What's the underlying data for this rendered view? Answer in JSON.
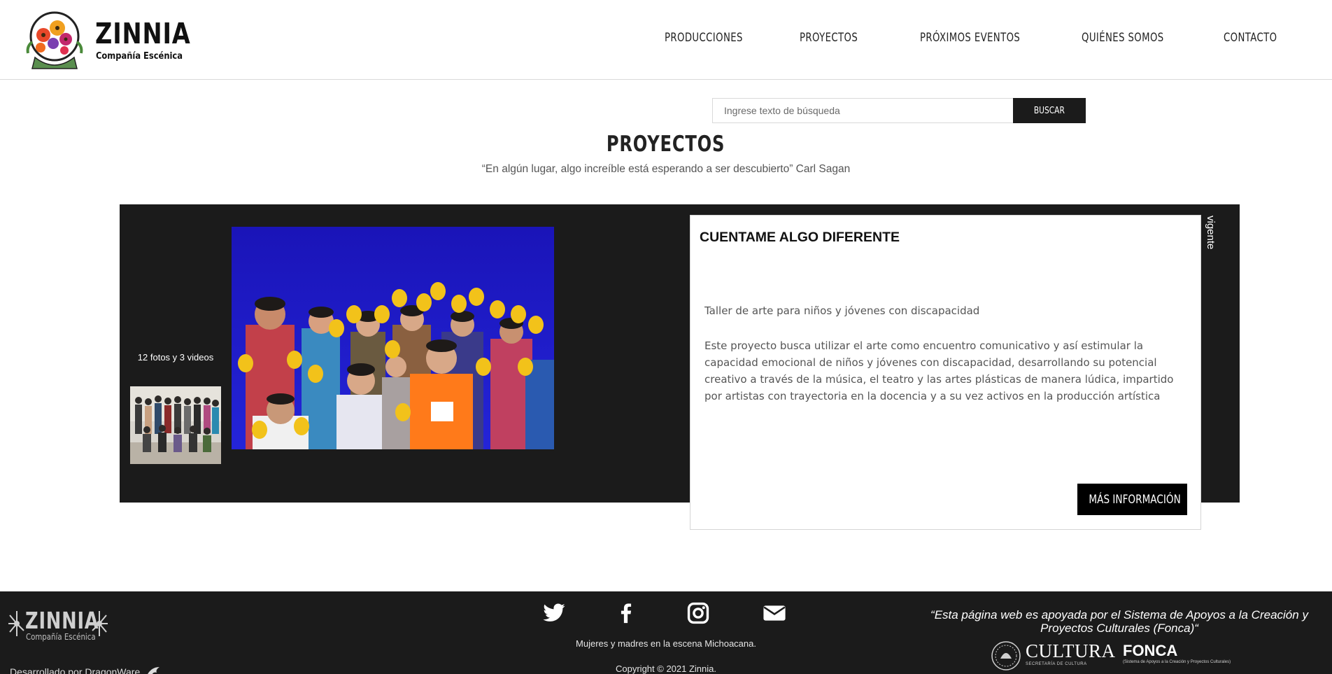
{
  "header": {
    "logo_name": "ZINNIA",
    "logo_subtitle": "Compañía Escénica",
    "nav": [
      {
        "label": "PRODUCCIONES"
      },
      {
        "label": "PROYECTOS"
      },
      {
        "label": "PRÓXIMOS EVENTOS"
      },
      {
        "label": "QUIÉNES SOMOS"
      },
      {
        "label": "CONTACTO"
      }
    ]
  },
  "search": {
    "placeholder": "Ingrese texto de búsqueda",
    "button_label": "BUSCAR"
  },
  "page": {
    "title": "PROYECTOS",
    "quote": "“En algún lugar, algo increíble está esperando a ser descubierto” Carl Sagan"
  },
  "project": {
    "media_count": "12 fotos y 3 videos",
    "status": "vigente",
    "title": "CUENTAME ALGO DIFERENTE",
    "subtitle": "Taller de arte para niños y jóvenes con discapacidad",
    "description": "Este proyecto busca utilizar el arte como encuentro comunicativo y así estimular la capacidad emocional de niños y jóvenes con discapacidad, desarrollando su potencial creativo a través de la música, el teatro y las artes plásticas de manera lúdica, impartido por artistas con trayectoria en la docencia y a su vez activos en la producción artística",
    "more_button": "MÁS INFORMACIÓN"
  },
  "footer": {
    "logo_name": "ZINNIA",
    "logo_subtitle": "Compañía Escénica",
    "developer": "Desarrollado por DragonWare",
    "social": [
      "twitter-icon",
      "facebook-icon",
      "instagram-icon",
      "envelope-icon"
    ],
    "tagline": "Mujeres y madres en la escena Michoacana.",
    "copyright": "Copyright © 2021 Zinnia.",
    "support": "“Esta página web es apoyada por el Sistema de Apoyos a la Creación y Proyectos Culturales (Fonca)“",
    "cultura_label": "CULTURA",
    "cultura_sub": "SECRETARÍA DE CULTURA",
    "fonca_label": "FONCA",
    "fonca_sub": "(Sistema de Apoyos a la Creación y Proyectos Culturales)"
  },
  "colors": {
    "band": "#1b1b1b",
    "button": "#000000",
    "photo_backdrop": "#1a1ad0",
    "glove": "#f2c21a",
    "shirt_orange": "#ff7a1a"
  }
}
